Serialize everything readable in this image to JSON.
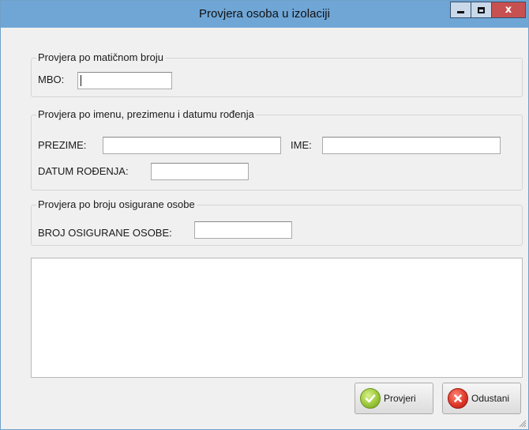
{
  "window": {
    "title": "Provjera osoba u izolaciji",
    "controls": {
      "minimize": "minimize",
      "maximize": "maximize",
      "close": "x"
    }
  },
  "mbo_group": {
    "legend": "Provjera po matičnom broju",
    "mbo_label": "MBO:",
    "mbo_value": ""
  },
  "name_group": {
    "legend": "Provjera po imenu, prezimenu i datumu rođenja",
    "prezime_label": "PREZIME:",
    "prezime_value": "",
    "ime_label": "IME:",
    "ime_value": "",
    "datum_label": "DATUM ROĐENJA:",
    "datum_value": ""
  },
  "insurance_group": {
    "legend": "Provjera po broju osigurane osobe",
    "broj_label": "BROJ OSIGURANE OSOBE:",
    "broj_value": ""
  },
  "results": {
    "text": ""
  },
  "buttons": {
    "check_label": "Provjeri",
    "cancel_label": "Odustani",
    "check_icon": "checkmark-icon",
    "cancel_icon": "cancel-x-icon"
  },
  "colors": {
    "titlebar": "#6fa6d6",
    "close_button": "#c75050",
    "window_bg": "#f0f0f0",
    "ok_green": "#9cc83a",
    "cancel_red": "#e03a2a"
  }
}
